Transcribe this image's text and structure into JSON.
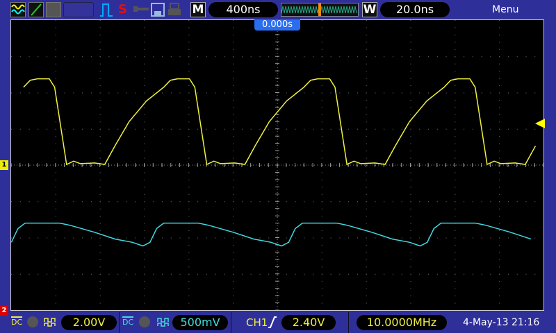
{
  "toolbar": {
    "timebase": "400ns",
    "memory_label": "M",
    "wave_label": "W",
    "wave_value": "20.0ns",
    "menu": "Menu",
    "status": "S"
  },
  "trigger_position": "0.000s",
  "channels": [
    {
      "id": "1",
      "coupling": "DC",
      "scale": "2.00V",
      "color": "#ffff40"
    },
    {
      "id": "2",
      "coupling": "DC",
      "scale": "500mV",
      "color": "#40e0e8"
    }
  ],
  "trigger": {
    "source": "CH1",
    "level": "2.40V"
  },
  "frequency": "10.0000MHz",
  "datetime": "4-May-13 21:16",
  "chart_data": {
    "type": "line",
    "xdivs": 12,
    "ydivs": 8,
    "series": [
      {
        "name": "CH1",
        "color": "#f0f040",
        "period_div": 3.16,
        "phase_div": 1.25,
        "points": [
          [
            0,
            0.02
          ],
          [
            0.16,
            0.11
          ],
          [
            0.31,
            0.04
          ],
          [
            0.63,
            0.06
          ],
          [
            0.86,
            0.02
          ],
          [
            1.09,
            0.53
          ],
          [
            1.41,
            1.2
          ],
          [
            1.8,
            1.77
          ],
          [
            2.19,
            2.15
          ],
          [
            2.34,
            2.34
          ],
          [
            2.5,
            2.38
          ],
          [
            2.77,
            2.38
          ],
          [
            2.89,
            2.15
          ],
          [
            3.16,
            0.02
          ]
        ]
      },
      {
        "name": "CH2",
        "color": "#40d8e0",
        "period_div": 3.125,
        "phase_div": 2.97,
        "points": [
          [
            0,
            -2.23
          ],
          [
            0.16,
            -2.13
          ],
          [
            0.31,
            -1.75
          ],
          [
            0.47,
            -1.6
          ],
          [
            1.25,
            -1.6
          ],
          [
            1.48,
            -1.66
          ],
          [
            2.03,
            -1.85
          ],
          [
            2.5,
            -2.04
          ],
          [
            2.89,
            -2.13
          ],
          [
            3.125,
            -2.23
          ]
        ]
      }
    ]
  }
}
